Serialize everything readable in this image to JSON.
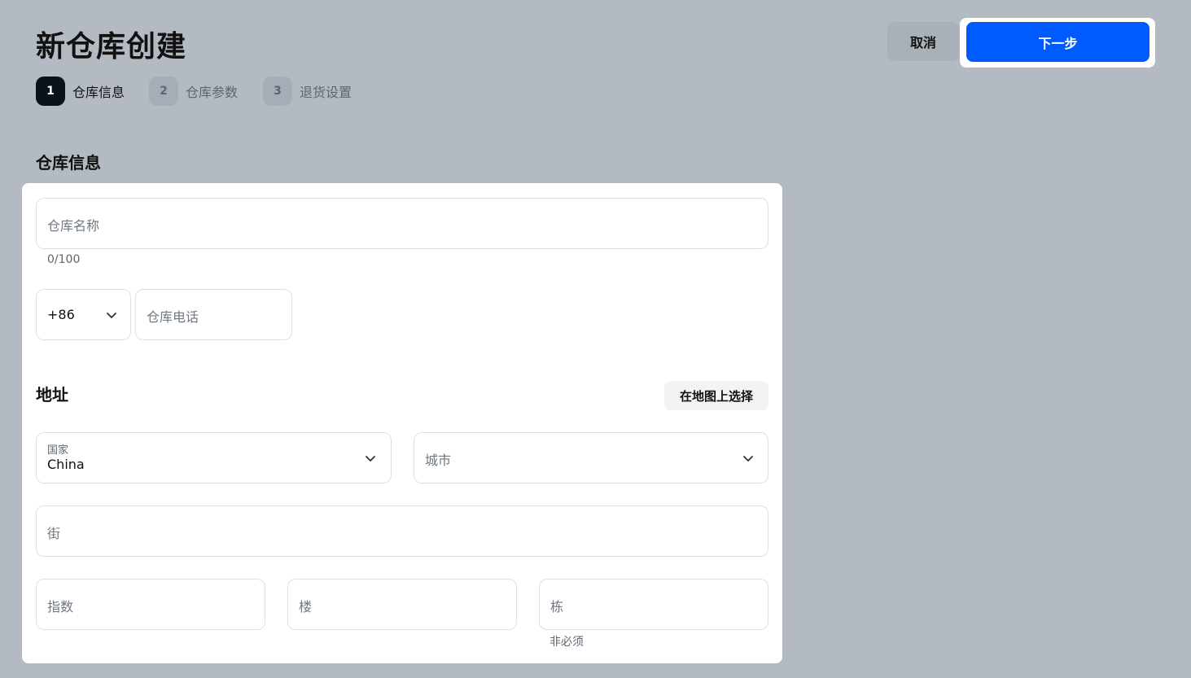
{
  "header": {
    "title": "新仓库创建",
    "cancel_label": "取消",
    "next_label": "下一步"
  },
  "steps": [
    {
      "num": "1",
      "label": "仓库信息",
      "state": "active"
    },
    {
      "num": "2",
      "label": "仓库参数",
      "state": "inactive"
    },
    {
      "num": "3",
      "label": "退货设置",
      "state": "inactive"
    }
  ],
  "section_title": "仓库信息",
  "form": {
    "name_placeholder": "仓库名称",
    "name_counter": "0/100",
    "phone_code": "+86",
    "phone_placeholder": "仓库电话",
    "address_title": "地址",
    "map_button": "在地图上选择",
    "country_label": "国家",
    "country_value": "China",
    "city_placeholder": "城市",
    "street_placeholder": "街",
    "index_placeholder": "指数",
    "floor_placeholder": "楼",
    "building_placeholder": "栋",
    "building_hint": "非必须"
  },
  "icons": {
    "dropdown": "chevron-down-icon"
  },
  "colors": {
    "primary": "#005bff",
    "background": "#b4bac2",
    "step_active": "#0b1118"
  }
}
